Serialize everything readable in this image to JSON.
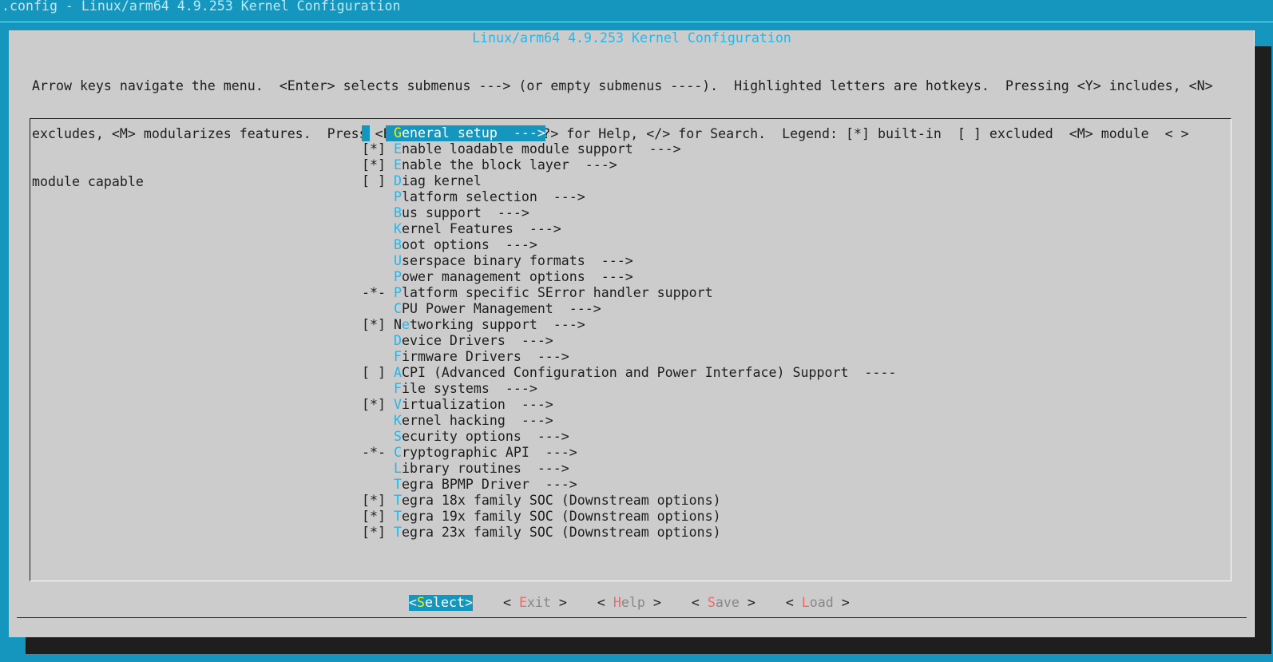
{
  "window_title": ".config - Linux/arm64 4.9.253 Kernel Configuration",
  "dialog_title": "Linux/arm64 4.9.253 Kernel Configuration",
  "help_lines": [
    "Arrow keys navigate the menu.  <Enter> selects submenus ---> (or empty submenus ----).  Highlighted letters are hotkeys.  Pressing <Y> includes, <N>",
    "excludes, <M> modularizes features.  Press <Esc><Esc> to exit, <?> for Help, </> for Search.  Legend: [*] built-in  [ ] excluded  <M> module  < >",
    "module capable"
  ],
  "menu_items": [
    {
      "prefix": "   ",
      "hotkey": "G",
      "rest": "eneral setup  --->",
      "selected": true
    },
    {
      "prefix": "[*]",
      "hotkey": "E",
      "rest": "nable loadable module support  --->"
    },
    {
      "prefix": "[*]",
      "hotkey": "E",
      "rest": "nable the block layer  --->"
    },
    {
      "prefix": "[ ]",
      "hotkey": "D",
      "rest": "iag kernel"
    },
    {
      "prefix": "   ",
      "hotkey": "P",
      "rest": "latform selection  --->"
    },
    {
      "prefix": "   ",
      "hotkey": "B",
      "rest": "us support  --->"
    },
    {
      "prefix": "   ",
      "hotkey": "K",
      "rest": "ernel Features  --->"
    },
    {
      "prefix": "   ",
      "hotkey": "B",
      "rest": "oot options  --->"
    },
    {
      "prefix": "   ",
      "hotkey": "U",
      "rest": "serspace binary formats  --->"
    },
    {
      "prefix": "   ",
      "hotkey": "P",
      "rest": "ower management options  --->"
    },
    {
      "prefix": "-*-",
      "hotkey": "P",
      "rest": "latform specific SError handler support"
    },
    {
      "prefix": "   ",
      "hotkey": "C",
      "rest": "PU Power Management  --->"
    },
    {
      "prefix": "[*]",
      "hotkey": "N",
      "rest": "etworking support  --->",
      "hotkey_index": 1
    },
    {
      "prefix": "   ",
      "hotkey": "D",
      "rest": "evice Drivers  --->"
    },
    {
      "prefix": "   ",
      "hotkey": "F",
      "rest": "irmware Drivers  --->"
    },
    {
      "prefix": "[ ]",
      "hotkey": "A",
      "rest": "CPI (Advanced Configuration and Power Interface) Support  ----"
    },
    {
      "prefix": "   ",
      "hotkey": "F",
      "rest": "ile systems  --->"
    },
    {
      "prefix": "[*]",
      "hotkey": "V",
      "rest": "irtualization  --->"
    },
    {
      "prefix": "   ",
      "hotkey": "K",
      "rest": "ernel hacking  --->"
    },
    {
      "prefix": "   ",
      "hotkey": "S",
      "rest": "ecurity options  --->"
    },
    {
      "prefix": "-*-",
      "hotkey": "C",
      "rest": "ryptographic API  --->"
    },
    {
      "prefix": "   ",
      "hotkey": "L",
      "rest": "ibrary routines  --->"
    },
    {
      "prefix": "   ",
      "hotkey": "T",
      "rest": "egra BPMP Driver  --->"
    },
    {
      "prefix": "[*]",
      "hotkey": "T",
      "rest": "egra 18x family SOC (Downstream options)"
    },
    {
      "prefix": "[*]",
      "hotkey": "T",
      "rest": "egra 19x family SOC (Downstream options)"
    },
    {
      "prefix": "[*]",
      "hotkey": "T",
      "rest": "egra 23x family SOC (Downstream options)"
    }
  ],
  "buttons": [
    {
      "open": "<",
      "hotkey": "S",
      "rest": "elect",
      "close": ">",
      "active": true
    },
    {
      "open": "< ",
      "hotkey": "E",
      "rest": "xit",
      "close": " >"
    },
    {
      "open": "< ",
      "hotkey": "H",
      "rest": "elp",
      "close": " >"
    },
    {
      "open": "< ",
      "hotkey": "S",
      "rest": "ave",
      "close": " >"
    },
    {
      "open": "< ",
      "hotkey": "L",
      "rest": "oad",
      "close": " >"
    }
  ],
  "colors": {
    "background": "#1496bf",
    "dialog": "#cccccc",
    "hotkey": "#29b5e6",
    "button_hotkey": "#f06868",
    "selected_hotkey": "#f0f000"
  }
}
